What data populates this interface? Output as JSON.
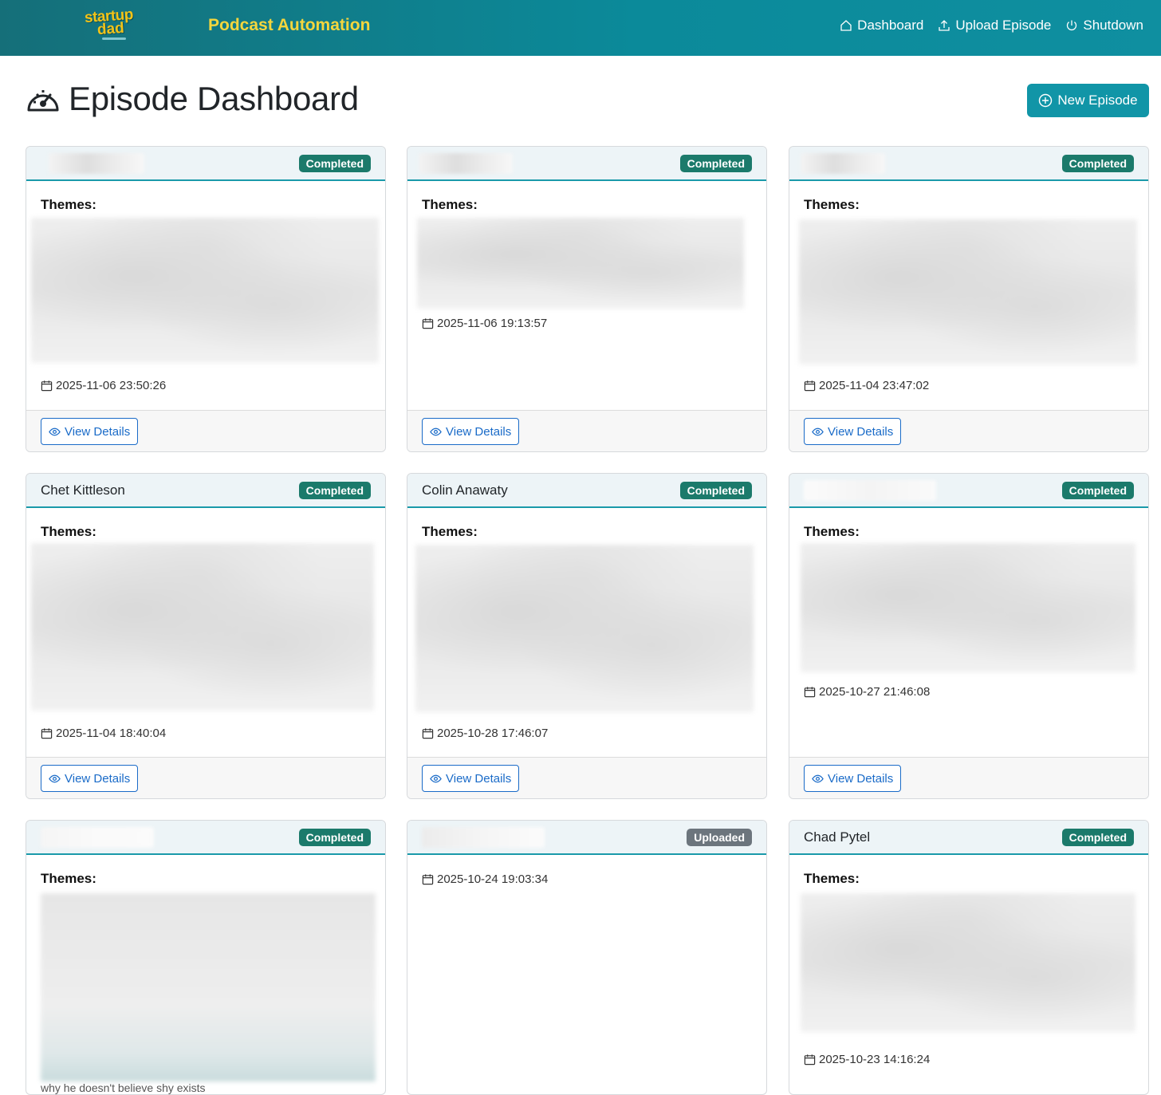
{
  "nav": {
    "logo_top": "startup",
    "logo_bottom": "dad",
    "brand": "Podcast Automation",
    "links": [
      {
        "label": "Dashboard",
        "icon": "house-icon"
      },
      {
        "label": "Upload Episode",
        "icon": "upload-icon"
      },
      {
        "label": "Shutdown",
        "icon": "power-icon"
      }
    ]
  },
  "page": {
    "title": "Episode Dashboard",
    "title_icon": "speedometer-icon",
    "new_button": "New Episode"
  },
  "labels": {
    "themes": "Themes:",
    "view_details": "View Details"
  },
  "colors": {
    "navbar": "#0b8a9a",
    "brand": "#f5d63d",
    "completed": "#1b7a6b",
    "uploaded": "#6c757d",
    "link": "#1a6bc8",
    "new_button": "#1195a7"
  },
  "episodes": [
    {
      "name": "",
      "status": "Completed",
      "date": "2025-11-06 23:50:26"
    },
    {
      "name": "",
      "status": "Completed",
      "date": "2025-11-06 19:13:57"
    },
    {
      "name": "",
      "status": "Completed",
      "date": "2025-11-04 23:47:02"
    },
    {
      "name": "Chet Kittleson",
      "status": "Completed",
      "date": "2025-11-04 18:40:04"
    },
    {
      "name": "Colin Anawaty",
      "status": "Completed",
      "date": "2025-10-28 17:46:07"
    },
    {
      "name": "",
      "status": "Completed",
      "date": "2025-10-27 21:46:08"
    },
    {
      "name": "",
      "status": "Completed",
      "date": "",
      "trailing_text": "why he doesn't believe shy exists"
    },
    {
      "name": "",
      "status": "Uploaded",
      "date": "2025-10-24 19:03:34"
    },
    {
      "name": "Chad Pytel",
      "status": "Completed",
      "date": "2025-10-23 14:16:24"
    }
  ]
}
